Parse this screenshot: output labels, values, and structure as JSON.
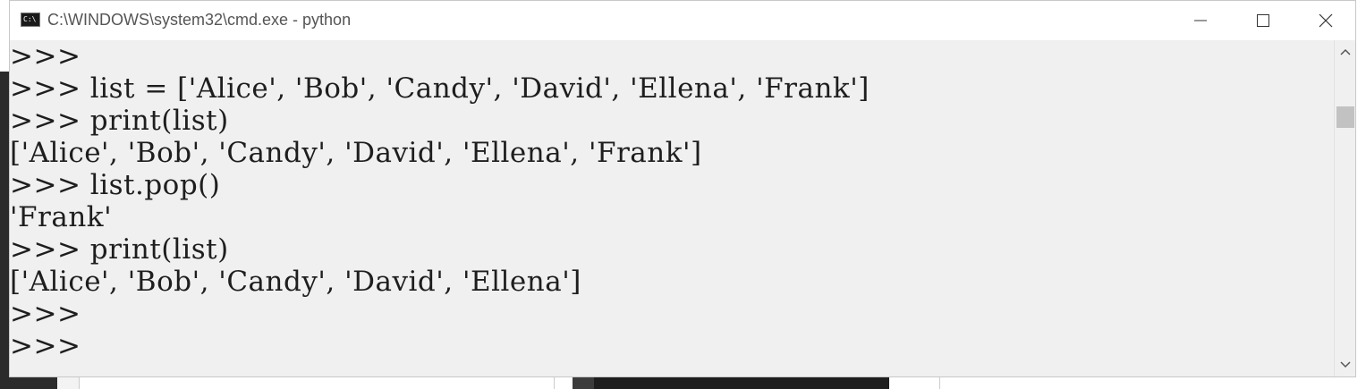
{
  "window": {
    "title": "C:\\WINDOWS\\system32\\cmd.exe - python",
    "icon": "cmd-icon",
    "icon_text": "C:\\",
    "controls": [
      "minimize-icon",
      "maximize-icon",
      "close-icon"
    ]
  },
  "console": {
    "lines": [
      ">>>",
      ">>> list = ['Alice', 'Bob', 'Candy', 'David', 'Ellena', 'Frank']",
      ">>> print(list)",
      "['Alice', 'Bob', 'Candy', 'David', 'Ellena', 'Frank']",
      ">>> list.pop()",
      "'Frank'",
      ">>> print(list)",
      "['Alice', 'Bob', 'Candy', 'David', 'Ellena']",
      ">>>",
      ">>>"
    ]
  },
  "scrollbar": {
    "up": "chevron-up-icon",
    "down": "chevron-down-icon"
  }
}
